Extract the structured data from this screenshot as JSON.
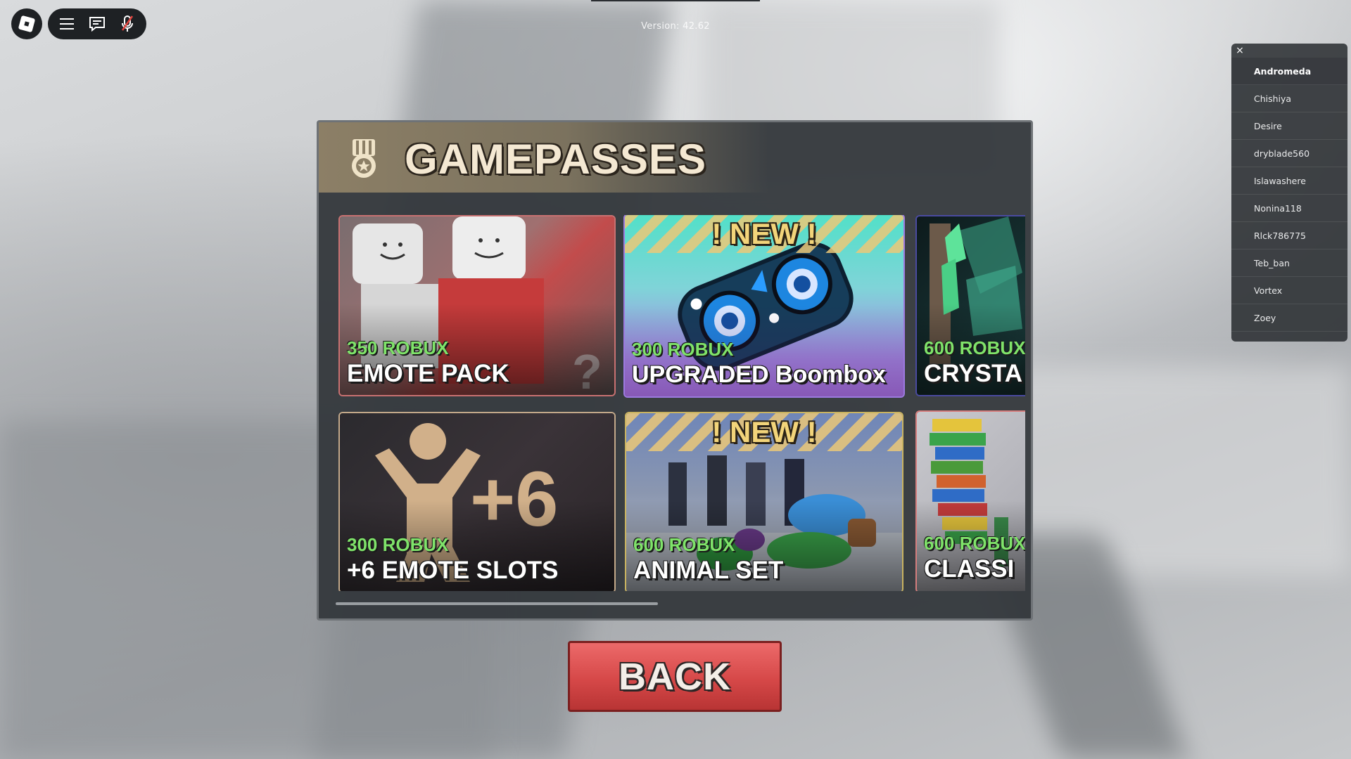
{
  "version_label": "Version: 42.62",
  "topbar": {
    "roblox_icon": "roblox-logo-icon",
    "menu_icon": "hamburger-menu-icon",
    "chat_icon": "chat-bubble-icon",
    "mic_icon": "microphone-muted-icon"
  },
  "player_list": {
    "close_glyph": "×",
    "players": [
      "Andromeda",
      "Chishiya",
      "Desire",
      "dryblade560",
      "Islawashere",
      "Nonina118",
      "Rlck786775",
      "Teb_ban",
      "Vortex",
      "Zoey"
    ]
  },
  "panel": {
    "title": "GAMEPASSES",
    "title_icon": "medal-icon",
    "cards": [
      {
        "price": "350 ROBUX",
        "name": "EMOTE PACK",
        "new": ""
      },
      {
        "price": "300 ROBUX",
        "name": "UPGRADED Boombox",
        "new": "! NEW !"
      },
      {
        "price": "600 ROBUX",
        "name": "CRYSTA",
        "new": ""
      },
      {
        "price": "300 ROBUX",
        "name": "+6 EMOTE SLOTS",
        "new": ""
      },
      {
        "price": "600 ROBUX",
        "name": "ANIMAL SET",
        "new": "! NEW !"
      },
      {
        "price": "600 ROBUX",
        "name": "CLASSI",
        "new": ""
      }
    ],
    "emote_slots_art_text": "+6"
  },
  "back_button": {
    "label": "BACK"
  },
  "colors": {
    "price_green": "#7fe36a",
    "back_red": "#d64848",
    "title_cream": "#f4e8d2",
    "panel_bg": "#34383c"
  }
}
